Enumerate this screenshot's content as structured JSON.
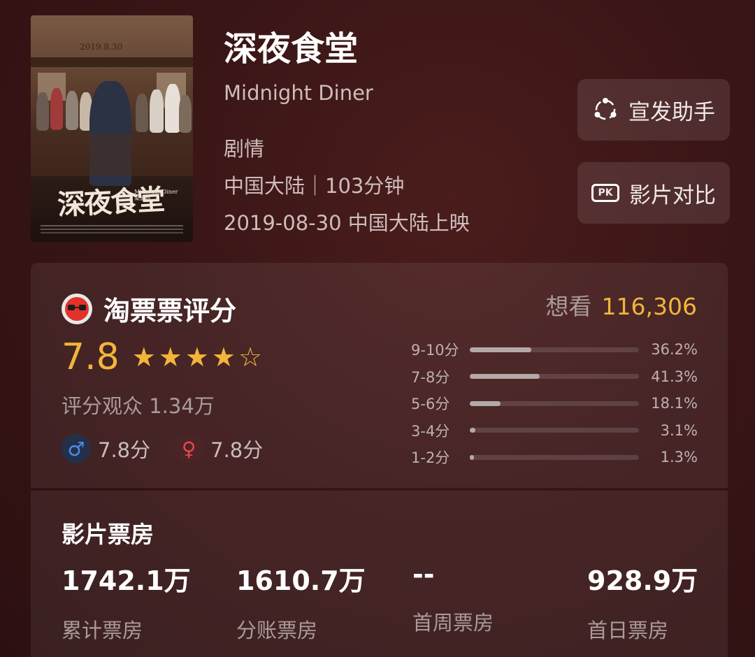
{
  "movie": {
    "title": "深夜食堂",
    "english_title": "Midnight Diner",
    "genre": "剧情",
    "region_duration": "中国大陆｜103分钟",
    "release": "2019-08-30 中国大陆上映",
    "poster": {
      "date": "2019.8.30",
      "calligraphy": "深夜食堂",
      "english": "Midnight Diner",
      "director": "梁家辉"
    }
  },
  "actions": {
    "promo_label": "宣发助手",
    "compare_label": "影片对比",
    "compare_badge": "PK"
  },
  "rating": {
    "brand": "淘票票评分",
    "want_label": "想看",
    "want_count": "116,306",
    "score": "7.8",
    "stars": "★★★★☆",
    "star_value": 4.5,
    "audience": "评分观众 1.34万",
    "male_score": "7.8分",
    "female_score": "7.8分",
    "male_symbol": "♂",
    "female_symbol": "♀",
    "distribution": [
      {
        "label": "9-10分",
        "percent": "36.2%",
        "value": 36.2
      },
      {
        "label": "7-8分",
        "percent": "41.3%",
        "value": 41.3
      },
      {
        "label": "5-6分",
        "percent": "18.1%",
        "value": 18.1
      },
      {
        "label": "3-4分",
        "percent": "3.1%",
        "value": 3.1
      },
      {
        "label": "1-2分",
        "percent": "1.3%",
        "value": 1.3
      }
    ]
  },
  "box_office": {
    "title": "影片票房",
    "items": [
      {
        "value": "1742.1万",
        "label": "累计票房"
      },
      {
        "value": "1610.7万",
        "label": "分账票房"
      },
      {
        "value": "--",
        "label": "首周票房"
      },
      {
        "value": "928.9万",
        "label": "首日票房"
      }
    ]
  },
  "colors": {
    "accent": "#f2b53a",
    "male": "#4b8bea",
    "female": "#e9454a",
    "background": "#3a1516"
  }
}
